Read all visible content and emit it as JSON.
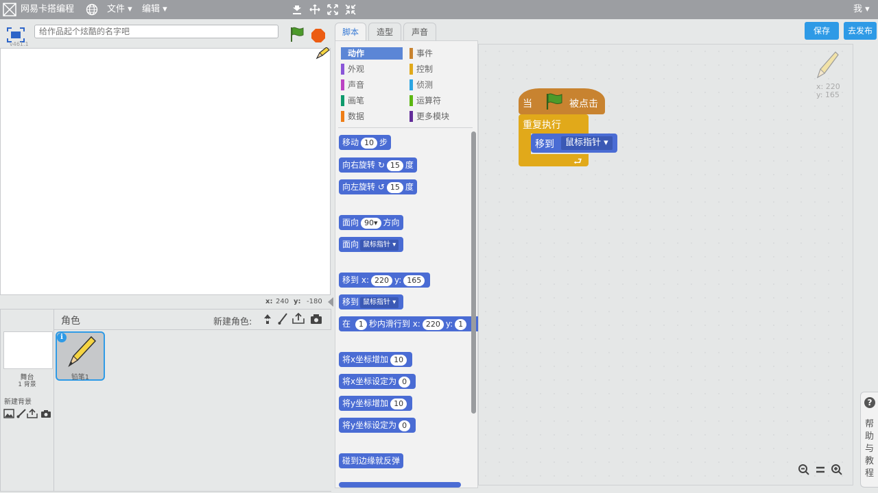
{
  "menubar": {
    "app_name": "网易卡搭编程",
    "file_label": "文件",
    "edit_label": "编辑",
    "user_label": "我"
  },
  "stage": {
    "title_placeholder": "给作品起个炫酷的名字吧",
    "version": "v461.1",
    "coord_x_label": "x:",
    "coord_x_value": "240",
    "coord_y_label": "y:",
    "coord_y_value": "-180"
  },
  "sprites": {
    "header_label": "角色",
    "new_sprite_label": "新建角色:",
    "stage_label": "舞台",
    "stage_backdrops": "1 背景",
    "new_backdrop_label": "新建背景",
    "sprite_name": "铅笔1"
  },
  "tabs": [
    {
      "label": "脚本"
    },
    {
      "label": "造型"
    },
    {
      "label": "声音"
    }
  ],
  "actions": {
    "save_label": "保存",
    "publish_label": "去发布",
    "help_label": "帮助与教程",
    "help_q": "?"
  },
  "palette": {
    "categories": [
      {
        "label": "动作",
        "color": "#4a6cd4"
      },
      {
        "label": "事件",
        "color": "#c88330"
      },
      {
        "label": "外观",
        "color": "#8a55d7"
      },
      {
        "label": "控制",
        "color": "#e1a91a"
      },
      {
        "label": "声音",
        "color": "#bb42c3"
      },
      {
        "label": "侦测",
        "color": "#2ca5e2"
      },
      {
        "label": "画笔",
        "color": "#0e9a6c"
      },
      {
        "label": "运算符",
        "color": "#5cb712"
      },
      {
        "label": "数据",
        "color": "#ee7d16"
      },
      {
        "label": "更多模块",
        "color": "#632d99"
      }
    ],
    "blocks": {
      "move": {
        "a": "移动",
        "n": "10",
        "b": "步"
      },
      "turn_right": {
        "a": "向右旋转",
        "n": "15",
        "b": "度"
      },
      "turn_left": {
        "a": "向左旋转",
        "n": "15",
        "b": "度"
      },
      "point_dir": {
        "a": "面向",
        "n": "90",
        "b": "方向"
      },
      "point_towards": {
        "a": "面向",
        "dd": "鼠标指针"
      },
      "goto_xy": {
        "a": "移到",
        "xl": "x:",
        "x": "220",
        "yl": "y:",
        "y": "165"
      },
      "goto": {
        "a": "移到",
        "dd": "鼠标指针"
      },
      "glide": {
        "a": "在",
        "n": "1",
        "b": "秒内滑行到",
        "xl": "x:",
        "x": "220",
        "yl": "y:",
        "y": "1"
      },
      "change_x": {
        "a": "将x坐标增加",
        "n": "10"
      },
      "set_x": {
        "a": "将x坐标设定为",
        "n": "0"
      },
      "change_y": {
        "a": "将y坐标增加",
        "n": "10"
      },
      "set_y": {
        "a": "将y坐标设定为",
        "n": "0"
      },
      "bounce": {
        "a": "碰到边缘就反弹"
      }
    }
  },
  "script": {
    "hat_when": "当",
    "hat_clicked": "被点击",
    "forever": "重复执行",
    "goto": "移到",
    "goto_target": "鼠标指针",
    "sprite_x_label": "x:",
    "sprite_x": "220",
    "sprite_y_label": "y:",
    "sprite_y": "165"
  }
}
